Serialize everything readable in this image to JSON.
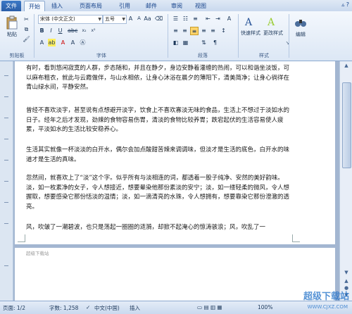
{
  "tabs": {
    "file": "文件",
    "home": "开始",
    "insert": "插入",
    "layout": "页面布局",
    "references": "引用",
    "mailings": "邮件",
    "review": "审阅",
    "view": "视图"
  },
  "ribbon": {
    "paste": "粘贴",
    "clipboard": "剪贴板",
    "font_name": "宋体 (中文正文)",
    "font_size": "五号",
    "font_group": "字体",
    "paragraph_group": "段落",
    "quick_styles": "快速样式",
    "change_styles": "更改样式",
    "styles_group": "样式",
    "edit": "编辑"
  },
  "document": {
    "paragraphs": [
      "有时，看到悠闲寂寞的人群，步态随和，并且在静夕，身边安静着灌缠的热闹，可以和谐坐淡饭，可以麻布粗衣，就此与云霞做伴，与山水相依，让身心沐浴在晨夕的薄阳下，清美简净；让身心徜徉在青山绿水间，平静安然。",
      "曾经不喜欢淡字，甚至说有点想避开淡字，饮食上不喜欢寡淡无味的食品，生活上不想过于淡如水的日子。经年之后才发现，劲辣的食物容易伤胃，清淡的食物比较养胃；跌宕起伏的生活容易使人疲累，平淡如水的生活比较安稳养心。",
      "生活其实就像一杯淡淡的白开水，偶尔会加点酸甜苦辣来调调味，但淡才是生活的底色，白开水的味道才是生活的真味。",
      "忽然间，就喜欢上了“淡”这个字。似乎所有与淡相连的词，都透着一股子纯净、安然的美好韵味。淡，如一枚素净的女子，令人想接近，想要晕染他那份素淡的安宁；淡，如一缕轻柔的微风，令人想握取，想要感染它那份恬淡的温情；淡，如一滴清亮的水珠，令人想拥有，想要靠染它那份澄澈的透亮。",
      "风，吹皱了一潮碧波，也只是荡起一圈圈的涟漪，却掀不起淹心的惊涛骇浪；风，吹乱了一"
    ],
    "footer_text": "超级下载站"
  },
  "status": {
    "page": "页面: 1/2",
    "word_count": "字数: 1,258",
    "language": "中文(中国)",
    "mode": "插入",
    "zoom": "100%"
  },
  "watermark": {
    "title": "超级下载站",
    "url": "WWW.CJXZ.COM"
  }
}
